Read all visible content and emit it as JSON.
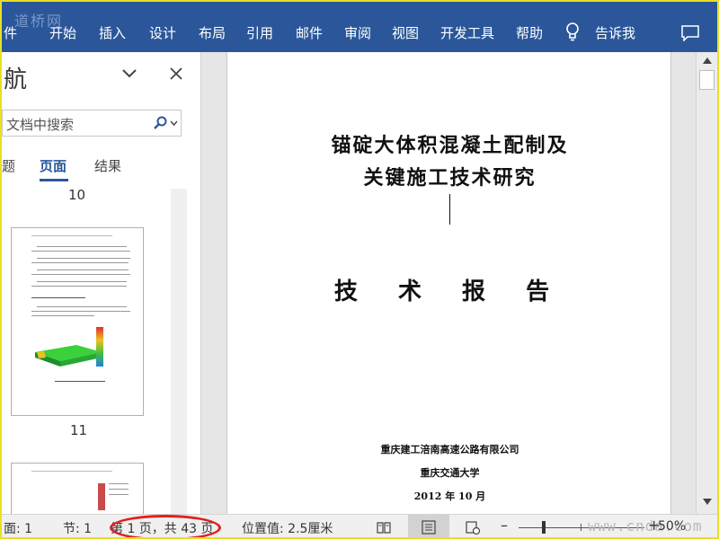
{
  "watermark_top": "道桥网",
  "ribbon": {
    "tabs": [
      "件",
      "开始",
      "插入",
      "设计",
      "布局",
      "引用",
      "邮件",
      "审阅",
      "视图",
      "开发工具",
      "帮助"
    ],
    "tell_me": "告诉我"
  },
  "nav_pane": {
    "title": "航",
    "search_placeholder": "文档中搜索",
    "tabs": [
      "题",
      "页面",
      "结果"
    ],
    "pages": [
      "10",
      "11"
    ]
  },
  "document": {
    "title_line_1": "锚碇大体积混凝土配制及",
    "title_line_2": "关键施工技术研究",
    "report_label": "技 术 报 告",
    "org_1": "重庆建工涪南高速公路有限公司",
    "org_2": "重庆交通大学",
    "date": "2012 年 10 月"
  },
  "status_bar": {
    "page": "面: 1",
    "section": "节: 1",
    "page_count": "第 1 页，共 43 页",
    "position": "位置值: 2.5厘米",
    "zoom_minus": "–",
    "zoom_plus": "+",
    "zoom_level": "50%",
    "zoom_percent": 50
  },
  "watermark_bottom": "www.cnda.com",
  "colors": {
    "ribbon": "#2b579a",
    "frame": "#e8e020",
    "highlight": "#e02020"
  }
}
